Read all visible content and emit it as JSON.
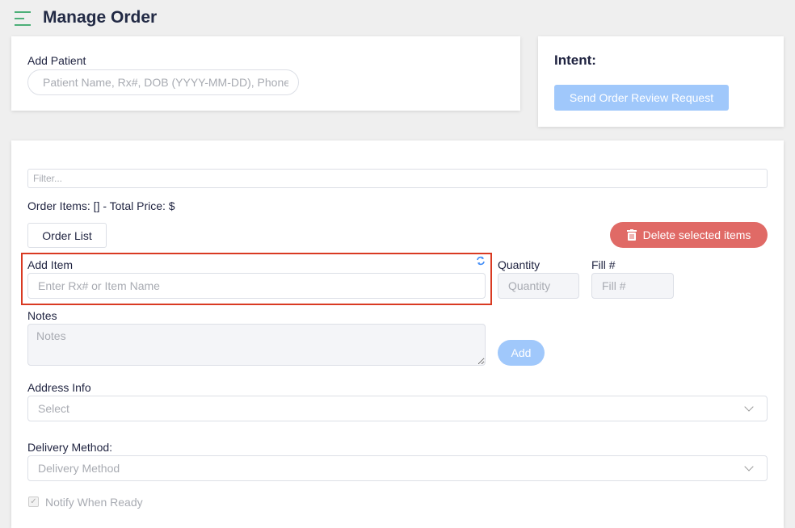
{
  "header": {
    "title": "Manage Order",
    "menu_icon": "hamburger-menu-icon"
  },
  "patient": {
    "label": "Add Patient",
    "placeholder": "Patient Name, Rx#, DOB (YYYY-MM-DD), Phone"
  },
  "intent": {
    "label": "Intent:",
    "button": "Send Order Review Request"
  },
  "order": {
    "filter_placeholder": "Filter...",
    "summary": "Order Items: [] - Total Price: $",
    "order_list_button": "Order List",
    "delete_button": "Delete selected items",
    "add_item_label": "Add Item",
    "add_item_placeholder": "Enter Rx# or Item Name",
    "quantity_label": "Quantity",
    "quantity_placeholder": "Quantity",
    "fill_label": "Fill #",
    "fill_placeholder": "Fill #",
    "notes_label": "Notes",
    "notes_placeholder": "Notes",
    "add_button": "Add",
    "address_label": "Address Info",
    "address_value": "Select",
    "delivery_label": "Delivery Method:",
    "delivery_value": "Delivery Method",
    "notify_label": "Notify When Ready",
    "notify_checked": true
  },
  "colors": {
    "accent": "#4caf78",
    "danger": "#e06a66",
    "primary_disabled": "#a0c8fb",
    "highlight": "#d93a22"
  }
}
